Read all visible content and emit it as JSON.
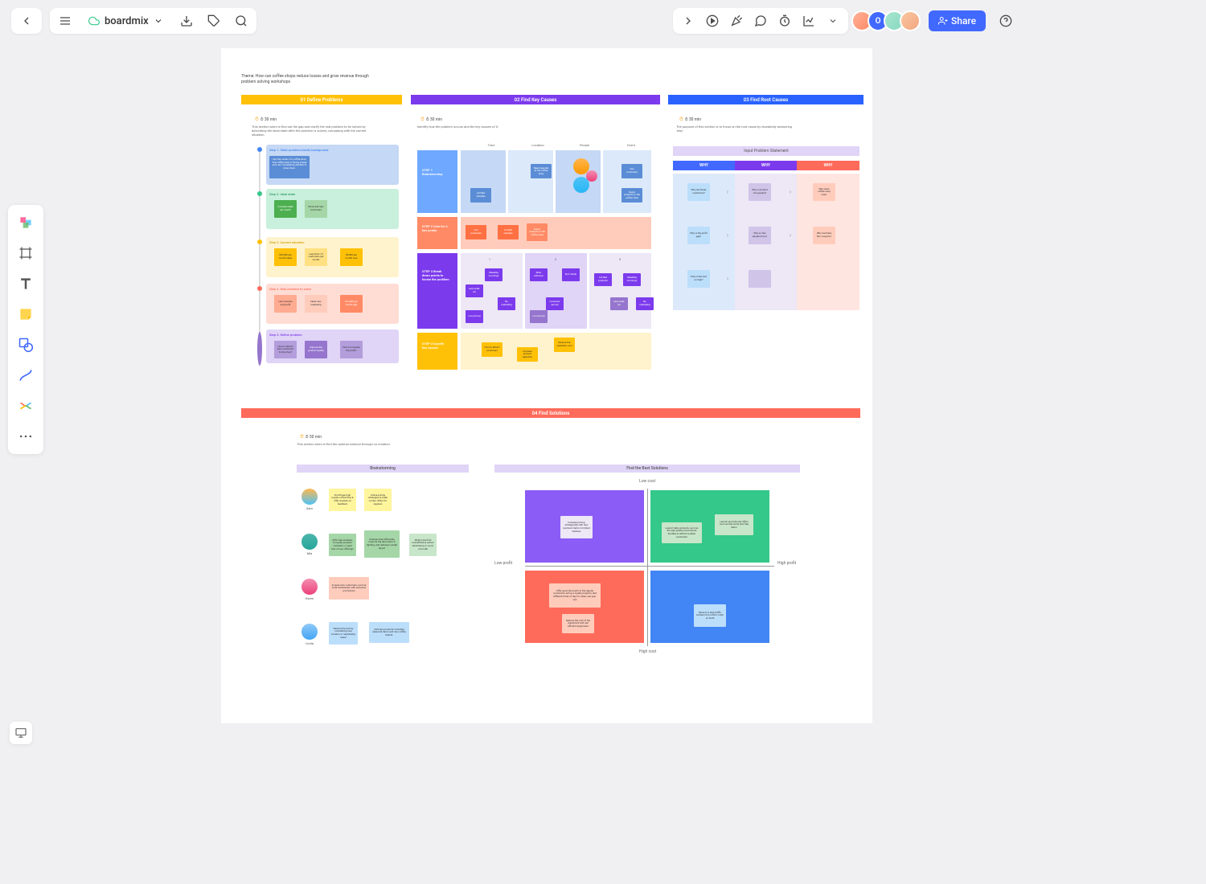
{
  "header": {
    "title": "boardmix",
    "share": "Share"
  },
  "theme": "Theme: How can coffee shops reduce losses and grow revenue through problem solving workshops",
  "sections": {
    "s1": {
      "title": "01 Define Problems",
      "time": "⏱ 30 min",
      "desc": "This section aims to find out the gap and clarify the real problem to be solved by describing the ideal state after the problem is solved, comparing with the current situation."
    },
    "s2": {
      "title": "02 Find Key Causes",
      "time": "⏱ 30 min",
      "desc": "Identify how the problem occurs and the key causes of it."
    },
    "s3": {
      "title": "03 Find Root Causes",
      "time": "⏱ 30 min",
      "desc": "The purpose of this section is to focus on the root cause by repeatedly answering 'why'."
    },
    "s4": {
      "title": "04 Find Solutions",
      "time": "⏱ 30 min",
      "desc": "This section aims to find the optimal solution through co-creation."
    }
  },
  "steps": {
    "s1": "Step 1. State problem/clarify background",
    "s2": "Step 2. Ideal state",
    "s3": "Step 3. Current situation",
    "s4": "Step 4. Real problem to solve",
    "s5": "Step 5. Refine problem"
  },
  "brainstorm": {
    "step1": "STEP 1\nBrainstorming",
    "step2": "STEP 2\nVote for 3 key\npoints",
    "step3": "STEP 3\nBreak down\npoints to\nlocate the\nproblem",
    "step4": "STEP 4\nSpecify key\ncauses",
    "cols": {
      "c1": "Time",
      "c2": "Location",
      "c3": "People",
      "c4": "Event"
    }
  },
  "why": {
    "input": "Input Problem Statement",
    "w1": "WHY",
    "w2": "WHY",
    "w3": "WHY"
  },
  "solutions": {
    "brainstorm": "Brainstorming",
    "best": "Find the Best Solutions",
    "people": {
      "p1": "Sam",
      "p2": "Mia",
      "p3": "Karen",
      "p4": "Linda"
    },
    "matrix": {
      "top": "Low cost",
      "bottom": "High cost",
      "left": "Low profit",
      "right": "High profit"
    }
  },
  "notes": {
    "n1": "I am the owner of a coffee shop. The coffee shop is facing losses and I am considering whether to close down.",
    "n2": "Increase sales per month",
    "n3": "More and new customers",
    "n4": "$20,000 per month sales",
    "n5": "Less than 15 customers per month",
    "n6": "$8,000 per month loss",
    "n7": "Less revenue and profit",
    "n8": "Need new marketing",
    "n9": "$12,000 per month gap",
    "n10": "How to attract new customers to the shop?",
    "n11": "Improve the product quality",
    "n12": "How to increase the profit?",
    "b1": "Need specials at the coffee shop",
    "b2": "Two customers",
    "b3": "Limited varieties",
    "b4": "Fewer products in the coffee shop",
    "v1": "Two customers",
    "v2": "Limited varieties",
    "v3": "Fewer products in the coffee shop",
    "d1": "Weekday mornings",
    "d2": "Less walk-ins",
    "d3": "No marketing",
    "d4": "Low pricing",
    "d5": "Main entrance",
    "d6": "Not visible",
    "d7": "Customer service",
    "d8": "Limited products",
    "sp1": "How to attract customers",
    "sp2": "Increase product selection",
    "sp3": "Reduce the operation cost",
    "w1": "Why are fewer customers?",
    "w2": "Why is product not popular?",
    "w3": "Why does coffee shop lose?",
    "w4": "Why is the profit gap?",
    "w5": "Why so few people know?",
    "w6": "Why are there few coupons?",
    "w7": "Why is the rent so high?",
    "sol1": "Find those high loyalty coffee fans & offer rewards on feedback",
    "sol2": "Online pricing strategies & make combo offers for regulars",
    "sol3": "Offer free samples, to loyalty program members, or paid test of new offerings",
    "sol4": "Arrange store efficiently, improve the decoration & lighting, and redesign overall layout",
    "sol5": "What is the first cost-effective action: advertising or word-of-mouth",
    "sol6": "Acquire new customers, such as local businesses, with exclusive promotions",
    "sol7": "Reduce the rent by considering new location or negotiating lease",
    "sol8": "Add new products, including seasonal items and new coffee blends",
    "sol9": "Increase pricing strategically with new premium items in limited batches",
    "sol10": "Launch daily products, such as through quality promotional bundles to attract & retain customers",
    "sol11": "Launch promotional offers such as discounts and free items",
    "sol12": "Offer good discounts to the regular customers, set up a loyalty program, test different times of day for sales, use pop-ups",
    "sol13": "Reduce the cost of the equipment and use efficient equipment",
    "sol14": "Move to a high traffic location but control costs on build"
  }
}
